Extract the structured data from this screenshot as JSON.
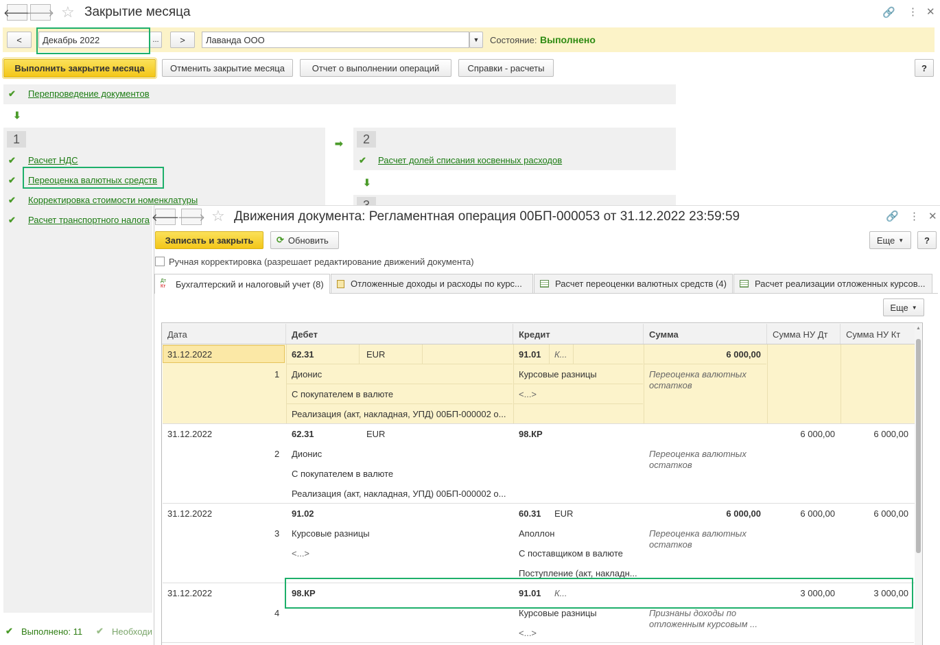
{
  "window1": {
    "title": "Закрытие месяца",
    "period_prev": "<",
    "period": "Декабрь 2022",
    "period_more": "...",
    "period_next": ">",
    "org": "Лаванда ООО",
    "state_label": "Состояние:",
    "state_value": "Выполнено",
    "buttons": {
      "run": "Выполнить закрытие месяца",
      "cancel": "Отменить закрытие месяца",
      "report": "Отчет о выполнении операций",
      "calc": "Справки - расчеты",
      "help": "?"
    },
    "repost": "Перепроведение документов",
    "step1": "1",
    "step2": "2",
    "step3": "3",
    "step1_items": [
      "Расчет НДС",
      "Переоценка валютных средств",
      "Корректировка стоимости номенклатуры",
      "Расчет транспортного налога"
    ],
    "step2_items": [
      "Расчет долей списания косвенных расходов"
    ],
    "footer_done": "Выполнено: 11",
    "footer_need": "Необходи"
  },
  "window2": {
    "title": "Движения документа: Регламентная операция 00БП-000053 от 31.12.2022 23:59:59",
    "save_close": "Записать и закрыть",
    "refresh": "Обновить",
    "more": "Еще",
    "help": "?",
    "manual_edit": "Ручная корректировка (разрешает редактирование движений документа)",
    "tabs": [
      "Бухгалтерский и налоговый учет (8)",
      "Отложенные доходы и расходы по курс...",
      "Расчет переоценки валютных средств (4)",
      "Расчет реализации отложенных курсов..."
    ],
    "dtkt_icon_text": "Дт Кт",
    "table_more": "Еще",
    "columns": [
      "Дата",
      "Дебет",
      "Кредит",
      "Сумма",
      "Сумма НУ Дт",
      "Сумма НУ Кт"
    ],
    "rows": [
      {
        "date": "31.12.2022",
        "num": "1",
        "debit_acc": "62.31",
        "debit_cur": "EUR",
        "debit_sub1": "Дионис",
        "debit_sub2": "С покупателем в валюте",
        "debit_sub3": "Реализация (акт, накладная, УПД) 00БП-000002 о...",
        "credit_acc": "91.01",
        "credit_cur": "К...",
        "credit_sub1": "Курсовые разницы",
        "credit_sub2": "<...>",
        "credit_sub3": "",
        "sum": "6 000,00",
        "comment": "Переоценка валютных остатков",
        "nu_dt": "",
        "nu_kt": ""
      },
      {
        "date": "31.12.2022",
        "num": "2",
        "debit_acc": "62.31",
        "debit_cur": "EUR",
        "debit_sub1": "Дионис",
        "debit_sub2": "С покупателем в валюте",
        "debit_sub3": "Реализация (акт, накладная, УПД) 00БП-000002 о...",
        "credit_acc": "98.КР",
        "credit_cur": "",
        "credit_sub1": "",
        "credit_sub2": "",
        "credit_sub3": "",
        "sum": "",
        "comment": "Переоценка валютных остатков",
        "nu_dt": "6 000,00",
        "nu_kt": "6 000,00"
      },
      {
        "date": "31.12.2022",
        "num": "3",
        "debit_acc": "91.02",
        "debit_cur": "",
        "debit_sub1": "Курсовые разницы",
        "debit_sub2": "<...>",
        "debit_sub3": "",
        "credit_acc": "60.31",
        "credit_cur": "EUR",
        "credit_sub1": "Аполлон",
        "credit_sub2": "С поставщиком в валюте",
        "credit_sub3": "Поступление (акт, накладн...",
        "sum": "6 000,00",
        "comment": "Переоценка валютных остатков",
        "nu_dt": "6 000,00",
        "nu_kt": "6 000,00"
      },
      {
        "date": "31.12.2022",
        "num": "4",
        "debit_acc": "98.КР",
        "debit_cur": "",
        "debit_sub1": "",
        "debit_sub2": "",
        "debit_sub3": "",
        "credit_acc": "91.01",
        "credit_cur": "К...",
        "credit_sub1": "Курсовые разницы",
        "credit_sub2": "<...>",
        "credit_sub3": "",
        "sum": "",
        "comment": "Признаны доходы по отложенным курсовым ...",
        "nu_dt": "3 000,00",
        "nu_kt": "3 000,00"
      }
    ]
  },
  "colors": {
    "accent_green": "#1b7b12",
    "highlight_box": "#1daf6a",
    "selected_row": "#fcf3cb",
    "yellow_button": "#f3c619"
  }
}
